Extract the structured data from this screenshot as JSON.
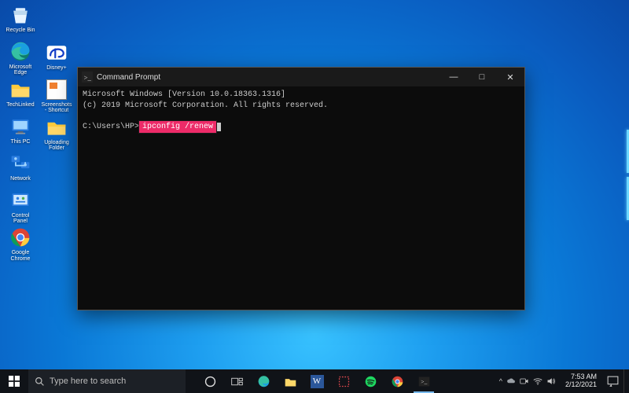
{
  "desktop": {
    "icons_col1": [
      {
        "name": "recycle-bin",
        "label": "Recycle Bin"
      },
      {
        "name": "microsoft-edge",
        "label": "Microsoft Edge"
      },
      {
        "name": "techlinked",
        "label": "TechLinked"
      },
      {
        "name": "this-pc",
        "label": "This PC"
      },
      {
        "name": "network",
        "label": "Network"
      },
      {
        "name": "control-panel",
        "label": "Control Panel"
      },
      {
        "name": "google-chrome",
        "label": "Google Chrome"
      }
    ],
    "icons_col2": [
      {
        "name": "disney-plus",
        "label": "Disney+"
      },
      {
        "name": "screenshots-shortcut",
        "label": "Screenshots - Shortcut"
      },
      {
        "name": "uploading-folder",
        "label": "Uploading Folder"
      }
    ]
  },
  "cmd": {
    "title": "Command Prompt",
    "line1": "Microsoft Windows [Version 10.0.18363.1316]",
    "line2": "(c) 2019 Microsoft Corporation. All rights reserved.",
    "prompt": "C:\\Users\\HP>",
    "command": "ipconfig /renew",
    "buttons": {
      "min": "—",
      "max": "□",
      "close": "✕"
    }
  },
  "taskbar": {
    "search_placeholder": "Type here to search",
    "tray_chevron": "^",
    "clock_time": "7:53 AM",
    "clock_date": "2/12/2021"
  }
}
